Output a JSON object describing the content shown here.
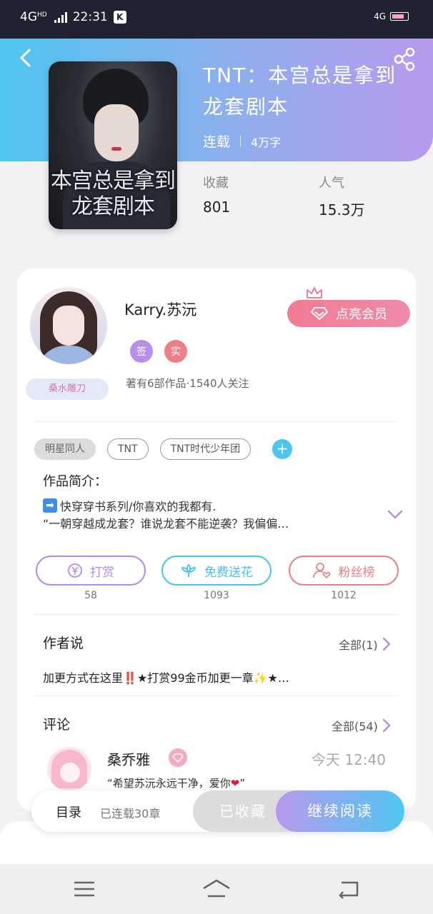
{
  "status_bar": {
    "network": "4G",
    "network_sup": "HD",
    "time": "22:31",
    "app_badge": "K",
    "right_network": "4G"
  },
  "header": {
    "title": "TNT：本宫总是拿到龙套剧本",
    "status": "连载",
    "word_count": "4万字",
    "cover_text": "本宫总是拿到龙套剧本"
  },
  "stats": [
    {
      "label": "收藏",
      "value": "801"
    },
    {
      "label": "人气",
      "value": "15.3万"
    }
  ],
  "author": {
    "name": "Karry.苏沅",
    "fan_badge": "桑水雕刀",
    "vip_button": "点亮会员",
    "roles": [
      "签",
      "实"
    ],
    "summary": "著有6部作品·1540人关注"
  },
  "tags": [
    "明星同人",
    "TNT",
    "TNT时代少年团"
  ],
  "intro": {
    "heading": "作品简介：",
    "line1": "快穿穿书系列/你喜欢的我都有.",
    "line2": "“一朝穿越成龙套？谁说龙套不能逆袭？我偏偏…"
  },
  "actions": [
    {
      "label": "打赏",
      "count": "58",
      "color": "#b489e8"
    },
    {
      "label": "免费送花",
      "count": "1093",
      "color": "#47c2e8"
    },
    {
      "label": "粉丝榜",
      "count": "1012",
      "color": "#ee7d82"
    }
  ],
  "author_says": {
    "heading": "作者说",
    "more": "全部(1)",
    "text": "加更方式在这里‼️★打赏99金币加更一章✨★…"
  },
  "comments": {
    "heading": "评论",
    "more": "全部(54)",
    "first": {
      "name": "桑乔雅",
      "time": "今天 12:40",
      "text": "“希望苏沅永远干净，爱你",
      "text_end": "”"
    }
  },
  "bottom_bar": {
    "menu": "目录",
    "chapters": "已连载30章",
    "favorited": "已收藏",
    "continue": "继续阅读"
  }
}
